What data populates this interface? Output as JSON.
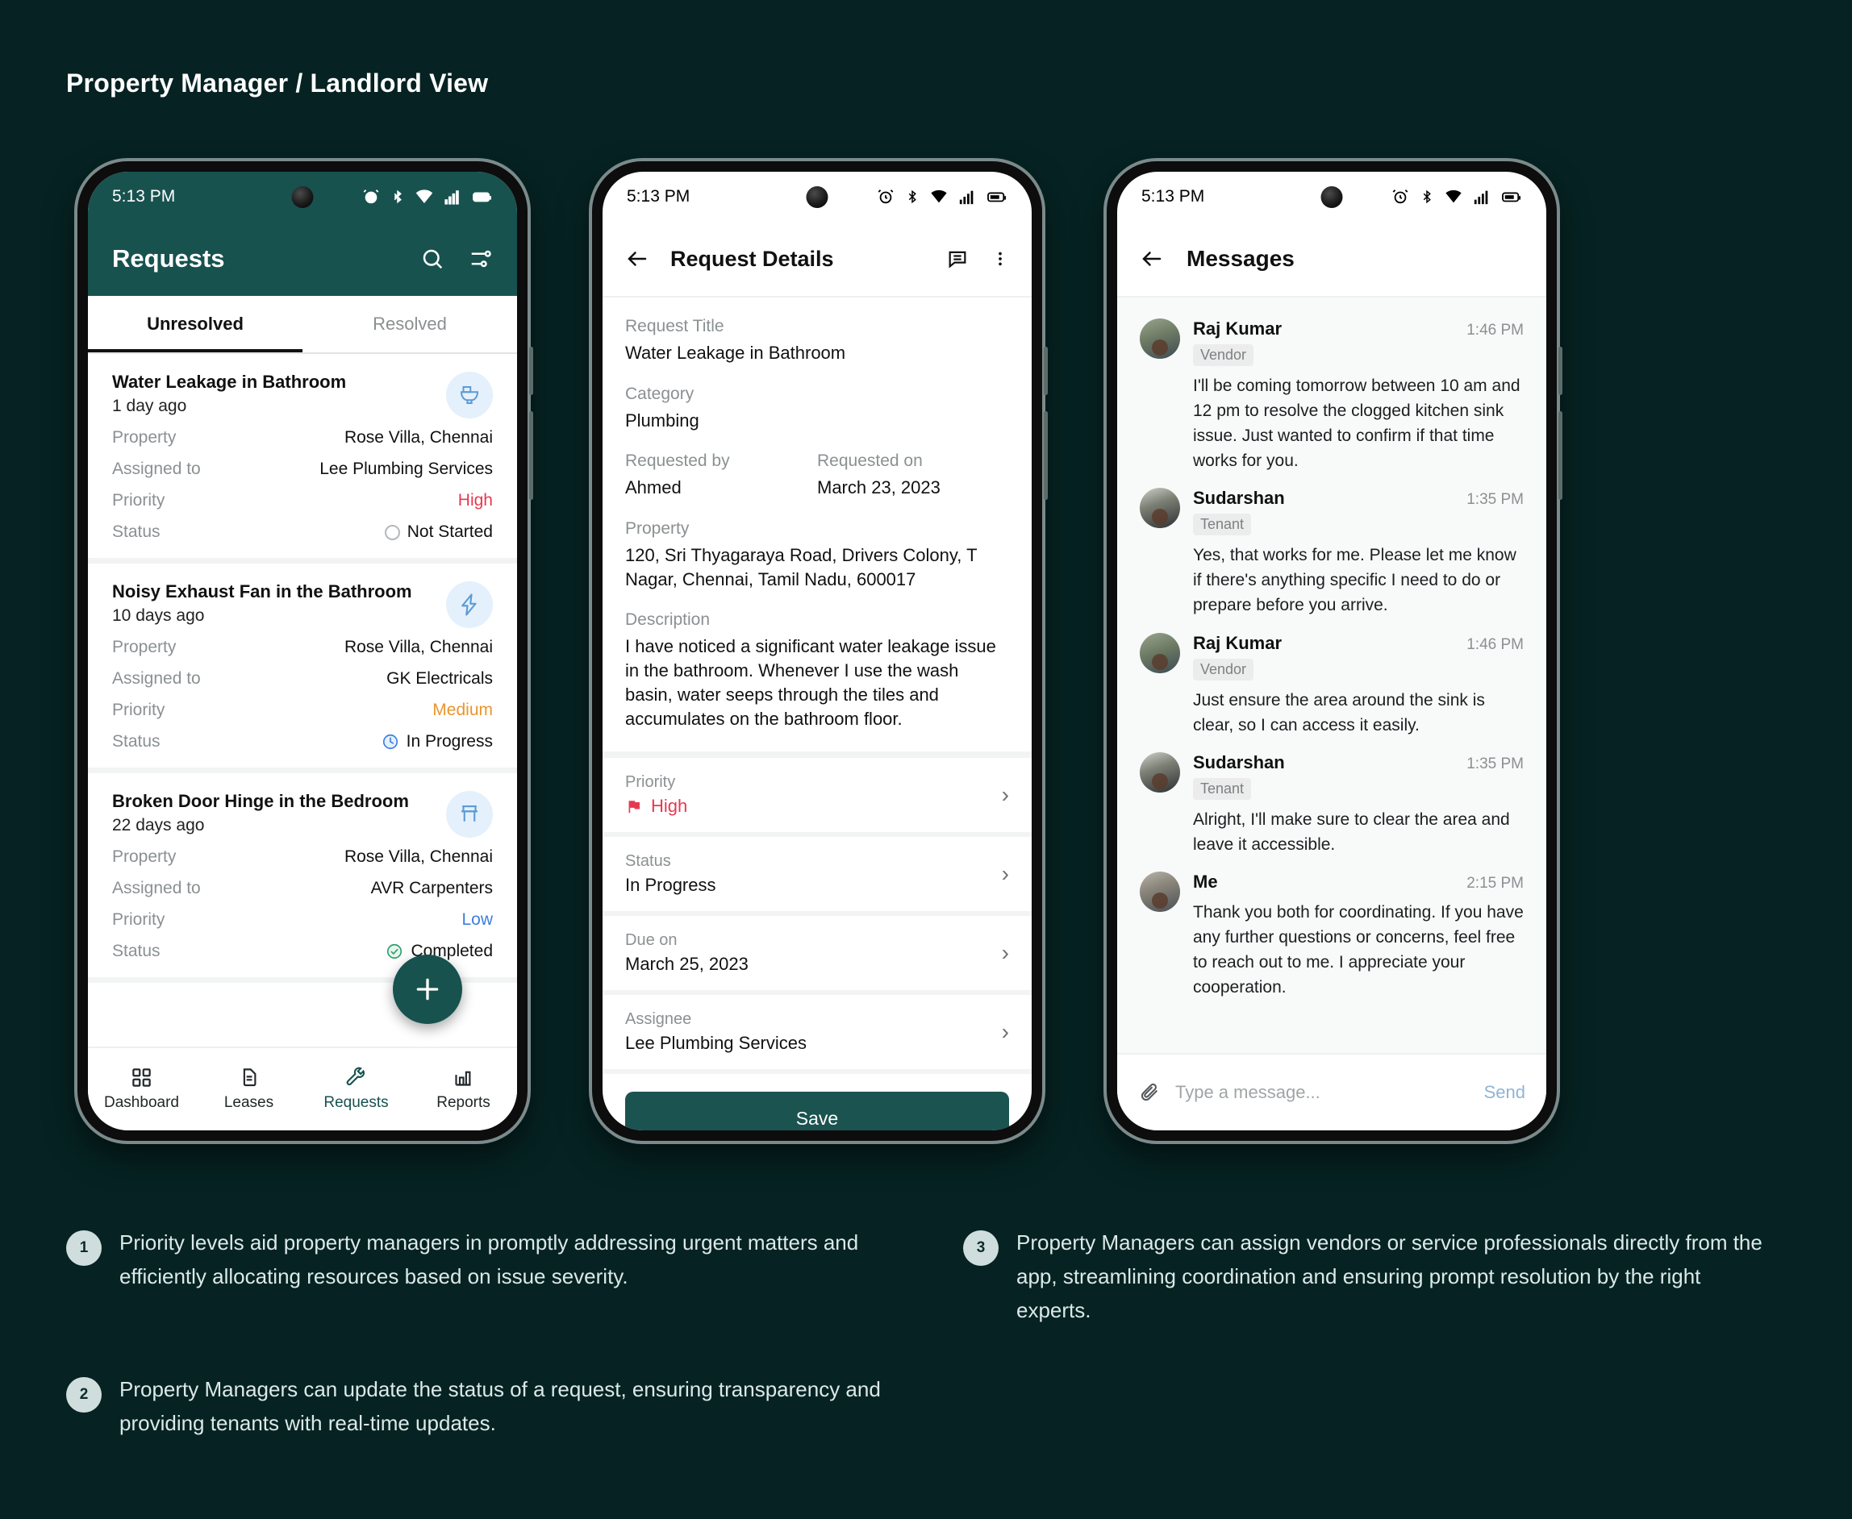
{
  "page": {
    "title": "Property Manager / Landlord View",
    "background": "#062222",
    "accent": "#17524f"
  },
  "phone1": {
    "statusbar": {
      "time": "5:13 PM",
      "icons": [
        "alarm-icon",
        "bluetooth-icon",
        "wifi-icon",
        "signal-icon",
        "battery-icon"
      ]
    },
    "appbar": {
      "title": "Requests",
      "search_icon": "search-icon",
      "filter_icon": "filter-icon"
    },
    "tabs": [
      {
        "label": "Unresolved",
        "active": true
      },
      {
        "label": "Resolved",
        "active": false
      }
    ],
    "field_labels": {
      "property": "Property",
      "assigned_to": "Assigned to",
      "priority": "Priority",
      "status": "Status"
    },
    "requests": [
      {
        "title": "Water Leakage in Bathroom",
        "age": "1 day ago",
        "icon": "toilet-icon",
        "property": "Rose Villa, Chennai",
        "assigned_to": "Lee Plumbing Services",
        "priority": "High",
        "priority_color": "#e63950",
        "status": "Not Started",
        "status_icon": "circle-outline-icon"
      },
      {
        "title": "Noisy Exhaust Fan in the Bathroom",
        "age": "10 days ago",
        "icon": "lightning-bolt-icon",
        "property": "Rose Villa, Chennai",
        "assigned_to": "GK Electricals",
        "priority": "Medium",
        "priority_color": "#e9962d",
        "status": "In Progress",
        "status_icon": "clock-icon"
      },
      {
        "title": "Broken Door Hinge in the Bedroom",
        "age": "22 days ago",
        "icon": "furniture-icon",
        "property": "Rose Villa, Chennai",
        "assigned_to": "AVR Carpenters",
        "priority": "Low",
        "priority_color": "#3d7fdd",
        "status": "Completed",
        "status_icon": "check-circle-icon"
      }
    ],
    "fab": {
      "icon": "plus-icon"
    },
    "bottomnav": [
      {
        "label": "Dashboard",
        "icon": "grid-icon",
        "active": false
      },
      {
        "label": "Leases",
        "icon": "document-icon",
        "active": false
      },
      {
        "label": "Requests",
        "icon": "wrench-icon",
        "active": true
      },
      {
        "label": "Reports",
        "icon": "bar-chart-icon",
        "active": false
      }
    ]
  },
  "phone2": {
    "statusbar": {
      "time": "5:13 PM"
    },
    "appbar": {
      "back_icon": "back-arrow-icon",
      "title": "Request Details",
      "chat_icon": "chat-icon",
      "more_icon": "more-vertical-icon"
    },
    "fields": {
      "request_title_label": "Request Title",
      "request_title_value": "Water Leakage in Bathroom",
      "category_label": "Category",
      "category_value": "Plumbing",
      "requested_by_label": "Requested by",
      "requested_by_value": "Ahmed",
      "requested_on_label": "Requested on",
      "requested_on_value": "March 23, 2023",
      "property_label": "Property",
      "property_value": "120, Sri Thyagaraya Road, Drivers Colony, T Nagar, Chennai, Tamil Nadu, 600017",
      "description_label": "Description",
      "description_value": "I have noticed a significant water leakage issue in the bathroom. Whenever I use the wash basin, water seeps through the tiles and accumulates on the bathroom floor."
    },
    "rows": [
      {
        "label": "Priority",
        "value": "High",
        "icon": "flag-icon",
        "value_color": "#e63950"
      },
      {
        "label": "Status",
        "value": "In Progress",
        "icon": "",
        "value_color": "#111111"
      },
      {
        "label": "Due on",
        "value": "March 25, 2023",
        "icon": "",
        "value_color": "#111111"
      },
      {
        "label": "Assignee",
        "value": "Lee Plumbing Services",
        "icon": "",
        "value_color": "#111111"
      }
    ],
    "save_label": "Save"
  },
  "phone3": {
    "statusbar": {
      "time": "5:13 PM"
    },
    "appbar": {
      "back_icon": "back-arrow-icon",
      "title": "Messages"
    },
    "messages": [
      {
        "name": "Raj Kumar",
        "role": "Vendor",
        "time": "1:46 PM",
        "text": "I'll be coming tomorrow between 10 am and 12 pm to resolve the clogged kitchen sink issue. Just wanted to confirm if that time works for you."
      },
      {
        "name": "Sudarshan",
        "role": "Tenant",
        "time": "1:35 PM",
        "text": "Yes, that works for me. Please let me know if there's anything specific I need to do or prepare before you arrive."
      },
      {
        "name": "Raj Kumar",
        "role": "Vendor",
        "time": "1:46 PM",
        "text": "Just ensure the area around the sink is clear, so I can access it easily."
      },
      {
        "name": "Sudarshan",
        "role": "Tenant",
        "time": "1:35 PM",
        "text": "Alright, I'll make sure to clear the area and leave it accessible."
      },
      {
        "name": "Me",
        "role": "",
        "time": "2:15 PM",
        "text": "Thank you both for coordinating. If you have any further questions or concerns, feel free to reach out to me. I appreciate your cooperation."
      }
    ],
    "composer": {
      "attach_icon": "paperclip-icon",
      "placeholder": "Type a message...",
      "send_label": "Send"
    }
  },
  "notes": [
    {
      "num": "1",
      "text": "Priority levels aid property managers in promptly addressing urgent matters and efficiently allocating resources based on issue severity."
    },
    {
      "num": "2",
      "text": "Property Managers can update the status of a request, ensuring transparency and providing tenants with real-time updates."
    },
    {
      "num": "3",
      "text": "Property Managers can assign vendors or service professionals directly from the app, streamlining coordination and ensuring prompt resolution by the right experts."
    }
  ]
}
